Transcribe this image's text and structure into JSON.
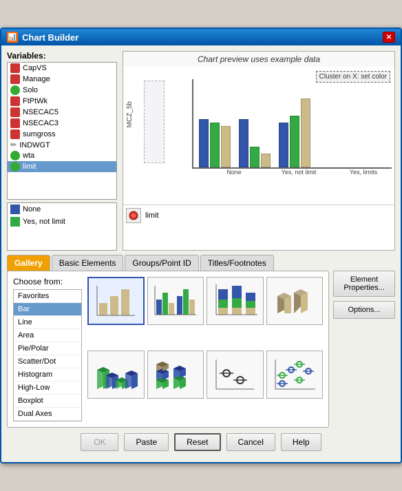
{
  "window": {
    "title": "Chart Builder",
    "icon": "chart-icon"
  },
  "header": {
    "preview_label": "Chart preview uses example data"
  },
  "variables": {
    "label": "Variables:",
    "items": [
      {
        "name": "CapVS",
        "icon_type": "scale"
      },
      {
        "name": "Manage",
        "icon_type": "scale"
      },
      {
        "name": "Solo",
        "icon_type": "nominal"
      },
      {
        "name": "FtPtWk",
        "icon_type": "scale"
      },
      {
        "name": "NSECAC5",
        "icon_type": "scale"
      },
      {
        "name": "NSECAC3",
        "icon_type": "scale"
      },
      {
        "name": "sumgross",
        "icon_type": "scale"
      },
      {
        "name": "INDWGT",
        "icon_type": "pencil"
      },
      {
        "name": "wta",
        "icon_type": "nominal"
      },
      {
        "name": "limit",
        "icon_type": "nominal"
      }
    ]
  },
  "legend": {
    "items": [
      {
        "label": "None",
        "color": "#3355aa"
      },
      {
        "label": "Yes, not limit",
        "color": "#33aa44"
      }
    ]
  },
  "chart": {
    "cluster_btn": "Cluster on X: set color",
    "y_axis_label": "MCZ_5b",
    "x_labels": [
      "None",
      "Yes, not limit",
      "Yes, limits"
    ],
    "legend_label": "limit"
  },
  "tabs": {
    "items": [
      {
        "label": "Gallery",
        "active": true
      },
      {
        "label": "Basic Elements",
        "active": false
      },
      {
        "label": "Groups/Point ID",
        "active": false
      },
      {
        "label": "Titles/Footnotes",
        "active": false
      }
    ]
  },
  "gallery": {
    "choose_from_label": "Choose from:",
    "list": [
      {
        "label": "Favorites",
        "selected": false
      },
      {
        "label": "Bar",
        "selected": true
      },
      {
        "label": "Line",
        "selected": false
      },
      {
        "label": "Area",
        "selected": false
      },
      {
        "label": "Pie/Polar",
        "selected": false
      },
      {
        "label": "Scatter/Dot",
        "selected": false
      },
      {
        "label": "Histogram",
        "selected": false
      },
      {
        "label": "High-Low",
        "selected": false
      },
      {
        "label": "Boxplot",
        "selected": false
      },
      {
        "label": "Dual Axes",
        "selected": false
      }
    ]
  },
  "sidebar": {
    "element_properties_label": "Element\nProperties...",
    "options_label": "Options..."
  },
  "buttons": {
    "ok": "OK",
    "paste": "Paste",
    "reset": "Reset",
    "cancel": "Cancel",
    "help": "Help"
  }
}
